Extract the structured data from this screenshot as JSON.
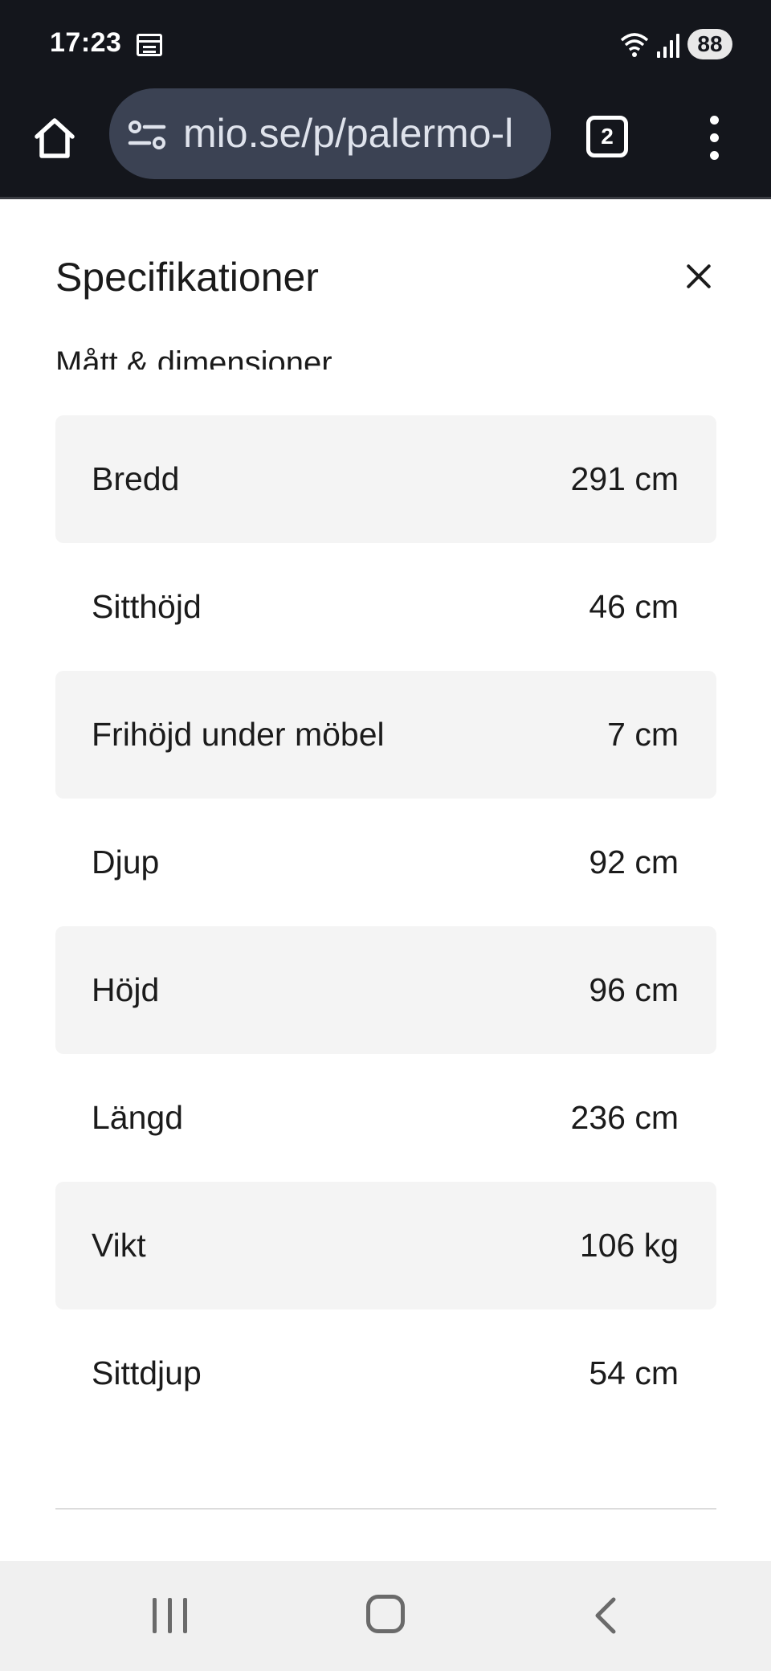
{
  "status_bar": {
    "time": "17:23",
    "battery": "88",
    "icons": [
      "calendar-icon",
      "wifi-icon",
      "signal-icon",
      "battery-icon"
    ]
  },
  "browser": {
    "url": "mio.se/p/palermo-l",
    "tab_count": "2",
    "icons": [
      "home-icon",
      "site-info-icon",
      "tabs-icon",
      "more-menu-icon"
    ]
  },
  "sheet": {
    "title": "Specifikationer",
    "section_heading": "Mått & dimensioner",
    "rows": [
      {
        "label": "Bredd",
        "value": "291 cm"
      },
      {
        "label": "Sitthöjd",
        "value": "46 cm"
      },
      {
        "label": "Frihöjd under möbel",
        "value": "7 cm"
      },
      {
        "label": "Djup",
        "value": "92 cm"
      },
      {
        "label": "Höjd",
        "value": "96 cm"
      },
      {
        "label": "Längd",
        "value": "236 cm"
      },
      {
        "label": "Vikt",
        "value": "106 kg"
      },
      {
        "label": "Sittdjup",
        "value": "54 cm"
      }
    ]
  },
  "nav_bar": {
    "icons": [
      "recents-icon",
      "home-icon",
      "back-icon"
    ]
  },
  "colors": {
    "dark_bar": "#14161c",
    "url_bar": "#3b4253",
    "row_shade": "#f4f4f4",
    "text": "#1b1b1b",
    "nav_bar": "#f0f0f0"
  }
}
